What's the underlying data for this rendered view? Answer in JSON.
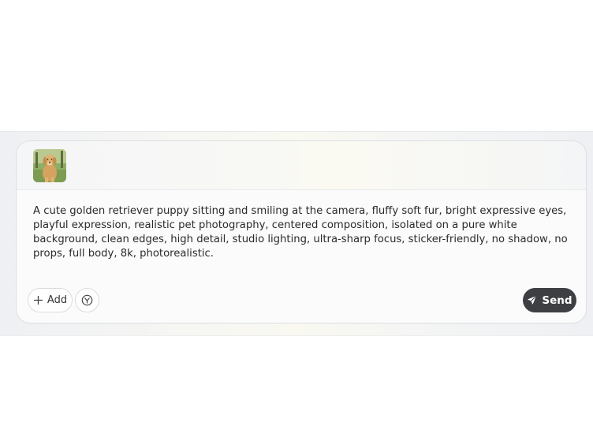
{
  "composer": {
    "attachment": {
      "icon": "dog-photo-thumbnail"
    },
    "prompt_text": "A cute golden retriever puppy sitting and smiling at the camera, fluffy soft fur, bright expressive eyes, playful expression, realistic pet photography, centered composition, isolated on a pure white background, clean edges, high detail, studio lighting, ultra-sharp focus, sticker-friendly, no shadow, no props, full body, 8k, photorealistic.",
    "add_label": "Add",
    "add_icon": "plus-icon",
    "option_icon": "filter-circle-icon",
    "send_label": "Send",
    "send_icon": "paper-plane-icon",
    "colors": {
      "send_bg": "#3d3f42",
      "card_bg": "#fbfbfb",
      "border": "#dcdfe3"
    }
  }
}
